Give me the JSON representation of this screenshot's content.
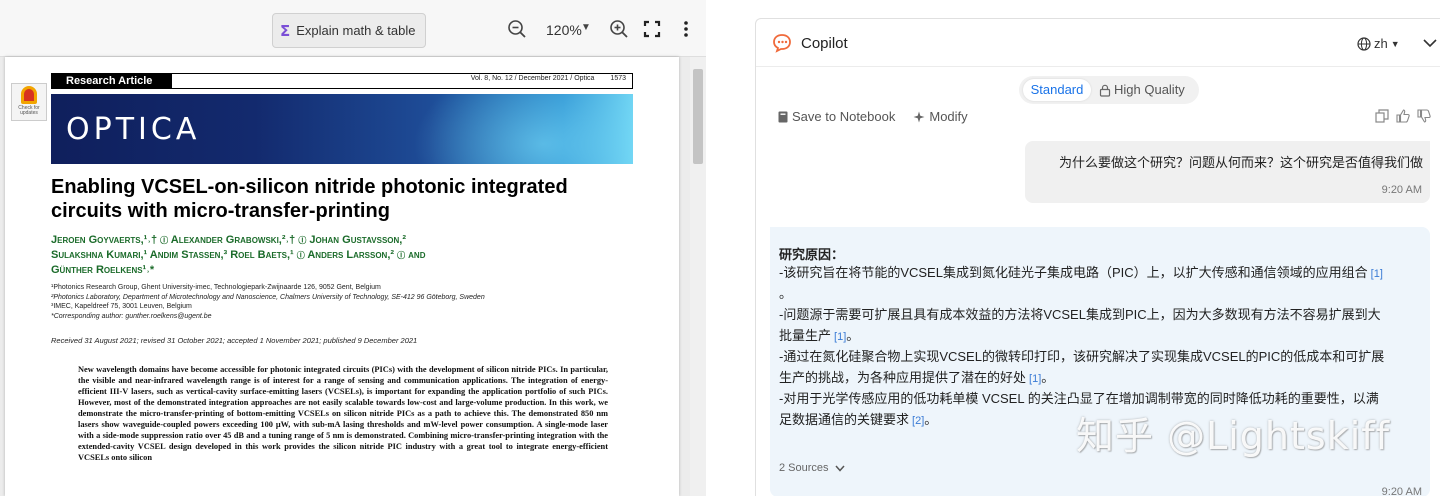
{
  "pdf_toolbar": {
    "explain_label": "Explain math & table",
    "zoom_level": "120%",
    "icons": [
      "sigma-icon",
      "zoom-out-icon",
      "zoom-in-icon",
      "fullscreen-icon",
      "more-vertical-icon"
    ]
  },
  "paper": {
    "check_badge": "Check for updates",
    "article_type": "Research Article",
    "journal_ref": "Vol. 8, No. 12 / December 2021 / Optica",
    "page_number": "1573",
    "journal_logo": "OPTICA",
    "title": "Enabling VCSEL-on-silicon nitride photonic integrated circuits with micro-transfer-printing",
    "authors": [
      "Jeroen Goyvaerts,¹˒† ⓘ Alexander Grabowski,²˒† ⓘ Johan Gustavsson,²",
      "Sulakshna Kumari,¹ Andim Stassen,³ Roel Baets,¹ ⓘ Anders Larsson,² ⓘ and",
      "Günther Roelkens¹˒*"
    ],
    "affiliations": [
      "¹Photonics Research Group, Ghent University-imec, Technologiepark-Zwijnaarde 126, 9052 Gent, Belgium",
      "²Photonics Laboratory, Department of Microtechnology and Nanoscience, Chalmers University of Technology, SE-412 96 Göteborg, Sweden",
      "³IMEC, Kapeldreef 75, 3001 Leuven, Belgium",
      "*Corresponding author: gunther.roelkens@ugent.be"
    ],
    "received": "Received 31 August 2021; revised 31 October 2021; accepted 1 November 2021; published 9 December 2021",
    "abstract": "New wavelength domains have become accessible for photonic integrated circuits (PICs) with the development of silicon nitride PICs. In particular, the visible and near-infrared wavelength range is of interest for a range of sensing and communication applications. The integration of energy-efficient III-V lasers, such as vertical-cavity surface-emitting lasers (VCSELs), is important for expanding the application portfolio of such PICs. However, most of the demonstrated integration approaches are not easily scalable towards low-cost and large-volume production. In this work, we demonstrate the micro-transfer-printing of bottom-emitting VCSELs on silicon nitride PICs as a path to achieve this. The demonstrated 850 nm lasers show waveguide-coupled powers exceeding 100 μW, with sub-mA lasing thresholds and mW-level power consumption. A single-mode laser with a side-mode suppression ratio over 45 dB and a tuning range of 5 nm is demonstrated. Combining micro-transfer-printing integration with the extended-cavity VCSEL design developed in this work provides the silicon nitride PIC industry with a great tool to integrate energy-efficient VCSELs onto silicon"
  },
  "copilot": {
    "title": "Copilot",
    "language": "zh",
    "modes": {
      "standard": "Standard",
      "high_quality": "High Quality"
    },
    "actions": {
      "save": "Save to Notebook",
      "modify": "Modify"
    },
    "user_message": {
      "text": "为什么要做这个研究？问题从何而来？这个研究是否值得我们做",
      "time": "9:20 AM"
    },
    "ai_message": {
      "heading": "研究原因：",
      "lines": [
        {
          "text": "-该研究旨在将节能的VCSEL集成到氮化硅光子集成电路（PIC）上，以扩大传感和通信领域的应用组合",
          "cite": "[1]"
        },
        {
          "text": "。",
          "cite": ""
        },
        {
          "text": "-问题源于需要可扩展且具有成本效益的方法将VCSEL集成到PIC上，因为大多数现有方法不容易扩展到大",
          "cite": ""
        },
        {
          "text": "批量生产",
          "cite": "[1]",
          "suffix": "。"
        },
        {
          "text": "-通过在氮化硅聚合物上实现VCSEL的微转印打印，该研究解决了实现集成VCSEL的PIC的低成本和可扩展",
          "cite": ""
        },
        {
          "text": "生产的挑战，为各种应用提供了潜在的好处",
          "cite": "[1]",
          "suffix": "。"
        },
        {
          "text": "-对用于光学传感应用的低功耗单模 VCSEL 的关注凸显了在增加调制带宽的同时降低功耗的重要性，以满",
          "cite": ""
        },
        {
          "text": "足数据通信的关键要求",
          "cite": "[2]",
          "suffix": "。"
        }
      ],
      "sources": "2 Sources",
      "time": "9:20 AM"
    }
  },
  "watermark": "知乎 @Lightskiff"
}
